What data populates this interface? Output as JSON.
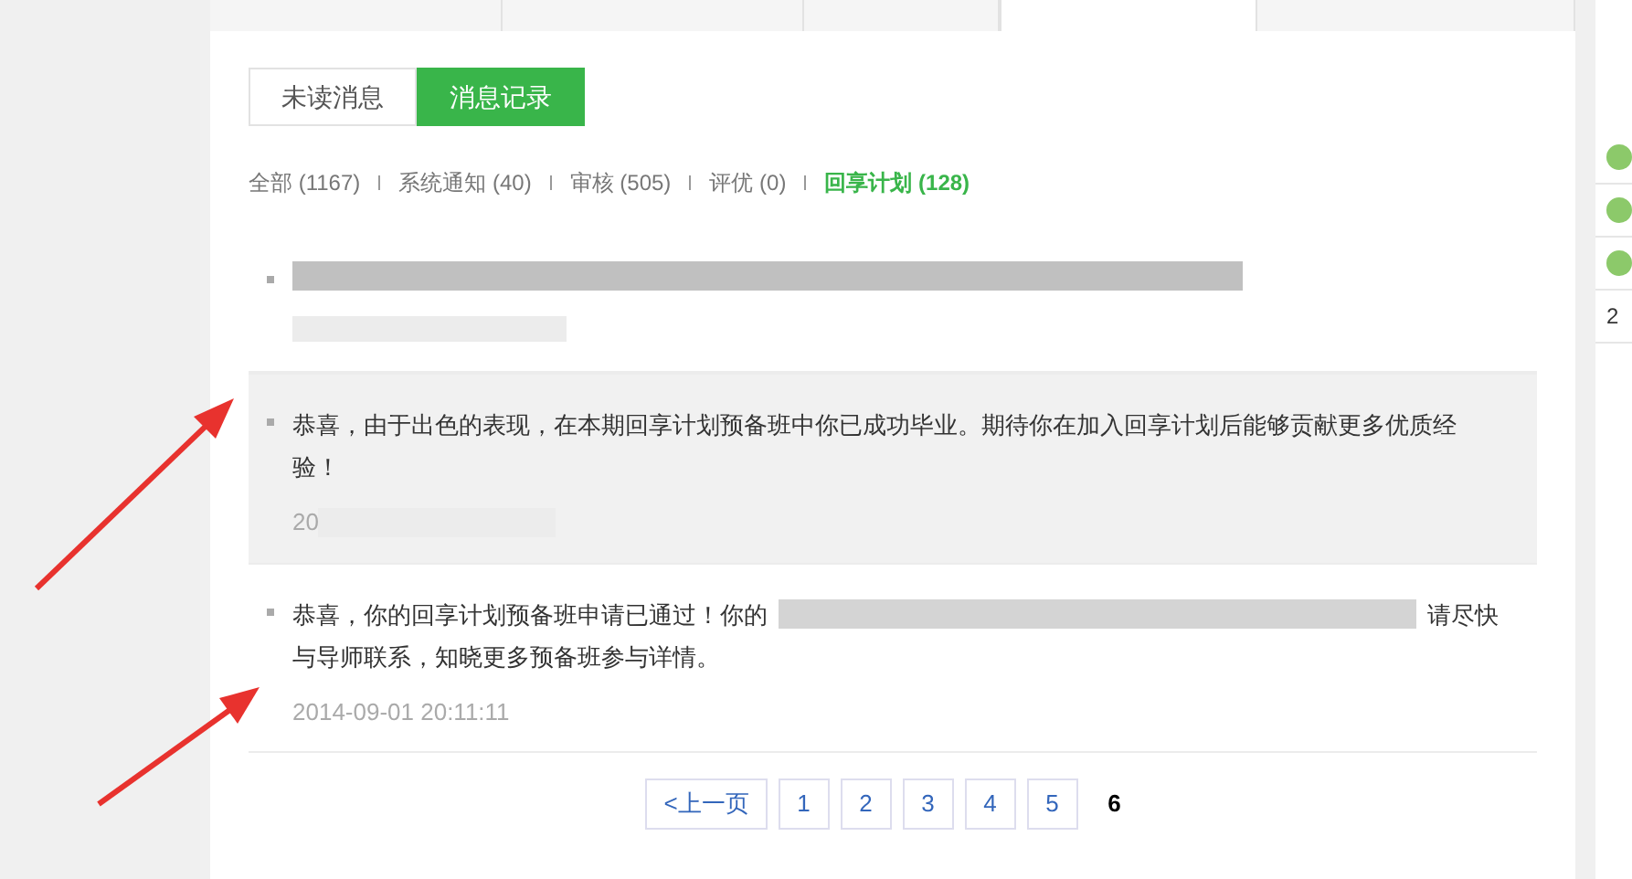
{
  "tabs": [
    {
      "selected": false
    },
    {
      "selected": false
    },
    {
      "selected": false
    },
    {
      "selected": true
    },
    {
      "selected": false
    }
  ],
  "subtabs": [
    {
      "label": "未读消息",
      "selected": false
    },
    {
      "label": "消息记录",
      "selected": true
    }
  ],
  "filters": [
    {
      "label": "全部 (1167)",
      "selected": false
    },
    {
      "label": "系统通知 (40)",
      "selected": false
    },
    {
      "label": "审核 (505)",
      "selected": false
    },
    {
      "label": "评优 (0)",
      "selected": false
    },
    {
      "label": "回享计划 (128)",
      "selected": true
    }
  ],
  "messages": [
    {
      "kind": "redacted",
      "highlighted": false
    },
    {
      "kind": "text",
      "highlighted": true,
      "text": "恭喜，由于出色的表现，在本期回享计划预备班中你已成功毕业。期待你在加入回享计划后能够贡献更多优质经验！",
      "time": "20"
    },
    {
      "kind": "partly_redacted",
      "highlighted": false,
      "text_before": "恭喜，你的回享计划预备班申请已通过！你的",
      "text_after": "请尽快",
      "text_line2": "与导师联系，知晓更多预备班参与详情。",
      "time": "2014-09-01 20:11:11"
    }
  ],
  "pagination": {
    "prev": "<上一页",
    "pages": [
      {
        "label": "1",
        "selected": false
      },
      {
        "label": "2",
        "selected": false
      },
      {
        "label": "3",
        "selected": false
      },
      {
        "label": "4",
        "selected": false
      },
      {
        "label": "5",
        "selected": false
      },
      {
        "label": "6",
        "selected": true
      }
    ]
  },
  "side_list": [
    {
      "kind": "badge"
    },
    {
      "kind": "badge"
    },
    {
      "kind": "badge"
    },
    {
      "kind": "text",
      "text": "2"
    }
  ]
}
